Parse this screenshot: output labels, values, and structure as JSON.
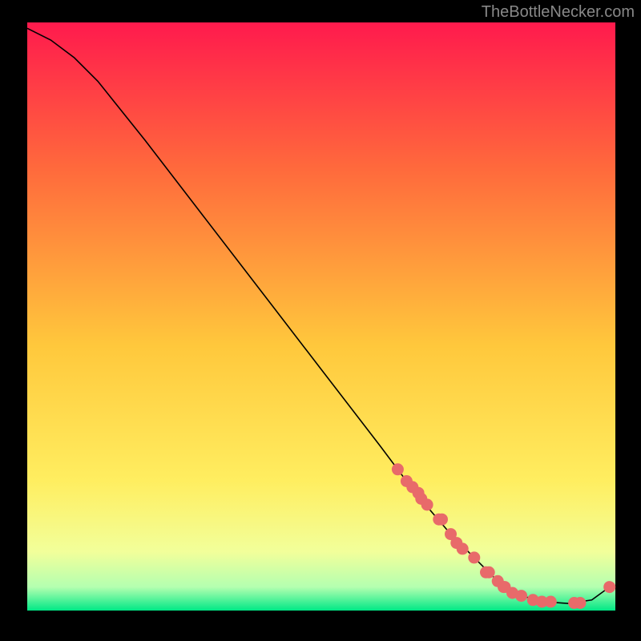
{
  "watermark": "TheBottleNecker.com",
  "chart_data": {
    "type": "line",
    "title": "",
    "xlabel": "",
    "ylabel": "",
    "xlim": [
      0,
      100
    ],
    "ylim": [
      0,
      100
    ],
    "background_gradient": {
      "top": "#ff1a4d",
      "mid_high": "#ff7040",
      "mid": "#ffc83c",
      "mid_low": "#ffee60",
      "low": "#eeffaa",
      "bottom": "#00e886"
    },
    "series": [
      {
        "name": "bottleneck-curve",
        "x": [
          0,
          4,
          8,
          12,
          20,
          30,
          40,
          50,
          60,
          66,
          72,
          76,
          80,
          84,
          88,
          92,
          96,
          99
        ],
        "y": [
          99,
          97,
          94,
          90,
          80,
          67,
          54,
          41,
          28,
          20,
          13,
          9,
          5,
          2.5,
          1.5,
          1.2,
          1.8,
          4
        ]
      }
    ],
    "scatter_points": {
      "name": "highlighted-points",
      "color": "#e86a6a",
      "x": [
        63,
        64.5,
        65.5,
        66.5,
        67,
        68,
        70,
        70.5,
        72,
        73,
        74,
        76,
        78,
        78.5,
        80,
        81,
        81.2,
        82.5,
        84,
        86,
        87.5,
        89,
        93,
        94,
        99
      ],
      "y": [
        24,
        22,
        21,
        20,
        19,
        18,
        15.5,
        15.5,
        13,
        11.5,
        10.5,
        9,
        6.5,
        6.5,
        5,
        4,
        4,
        3,
        2.5,
        1.8,
        1.5,
        1.5,
        1.3,
        1.3,
        4
      ]
    }
  }
}
